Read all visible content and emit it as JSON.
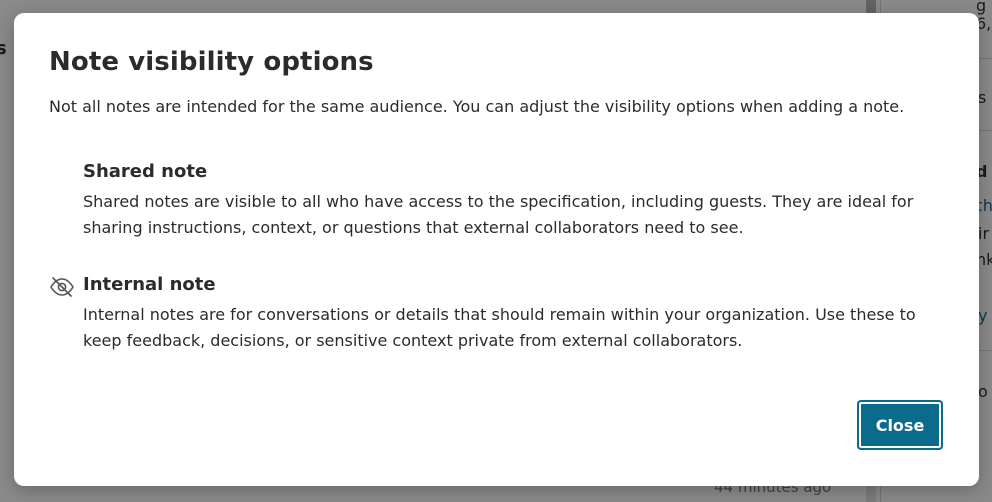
{
  "background": {
    "left_heading": "s",
    "side_fragments": [
      "g",
      "6,",
      "s",
      "d",
      "ch",
      "ir",
      "nk",
      "y",
      "o"
    ],
    "timestamp": "44 minutes ago"
  },
  "modal": {
    "title": "Note visibility options",
    "intro": "Not all notes are intended for the same audience. You can adjust the visibility options when adding a note.",
    "options": [
      {
        "title": "Shared note",
        "description": "Shared notes are visible to all who have access to the specification, including guests. They are ideal for sharing instructions, context, or questions that external collaborators need to see.",
        "icon": null
      },
      {
        "title": "Internal note",
        "description": "Internal notes are for conversations or details that should remain within your organization. Use these to keep feedback, decisions, or sensitive context private from external collaborators.",
        "icon": "eye-slash-icon"
      }
    ],
    "close_label": "Close"
  },
  "colors": {
    "primary_button": "#0b6b8d",
    "overlay": "rgba(0,0,0,0.46)",
    "text": "#2b2b2b"
  }
}
